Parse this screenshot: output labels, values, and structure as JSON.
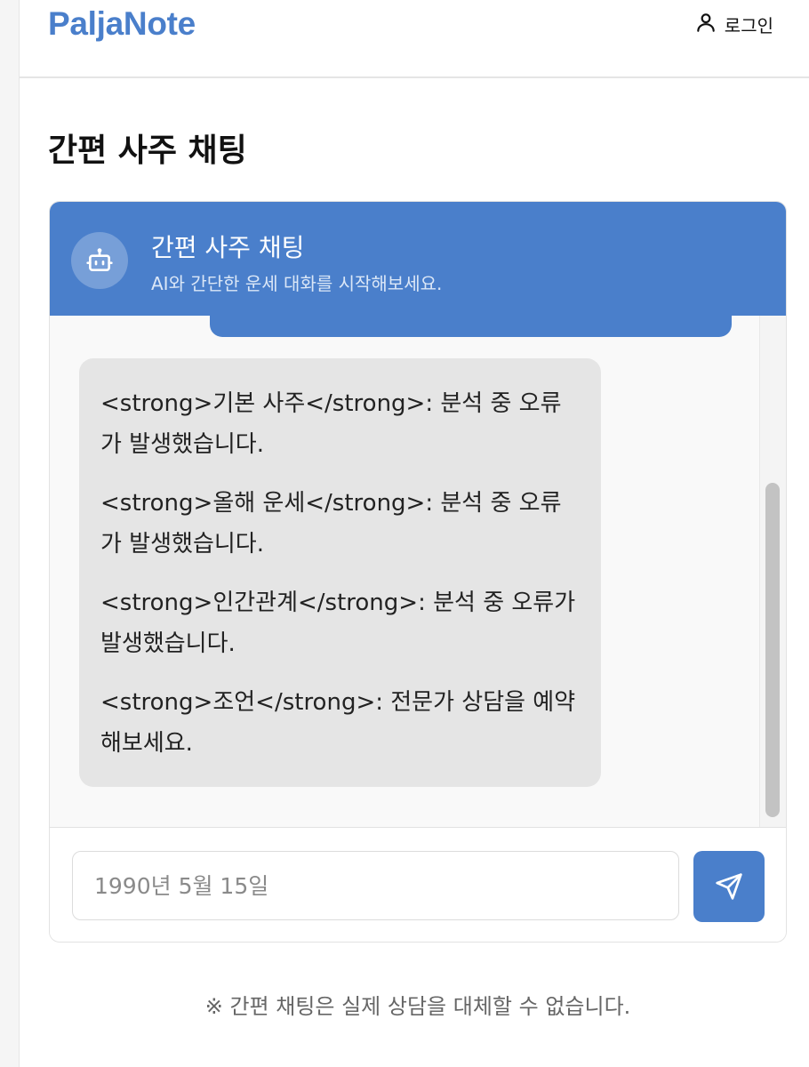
{
  "header": {
    "logo": "PaljaNote",
    "login_label": "로그인",
    "login_icon": "user-icon"
  },
  "page": {
    "title": "간편 사주 채팅"
  },
  "chat": {
    "title": "간편 사주 채팅",
    "subtitle": "AI와 간단한 운세 대화를 시작해보세요.",
    "avatar_icon": "robot-icon",
    "messages": [
      "<strong>기본 사주</strong>: 분석 중 오류가 발생했습니다.",
      "<strong>올해 운세</strong>: 분석 중 오류가 발생했습니다.",
      "<strong>인간관계</strong>: 분석 중 오류가 발생했습니다.",
      "<strong>조언</strong>: 전문가 상담을 예약해보세요."
    ],
    "input_placeholder": "1990년 5월 15일",
    "send_icon": "send-icon"
  },
  "footer": {
    "disclaimer": "※ 간편 채팅은 실제 상담을 대체할 수 없습니다."
  },
  "colors": {
    "accent": "#4a7fcb",
    "bot_bubble": "#e5e5e5"
  }
}
